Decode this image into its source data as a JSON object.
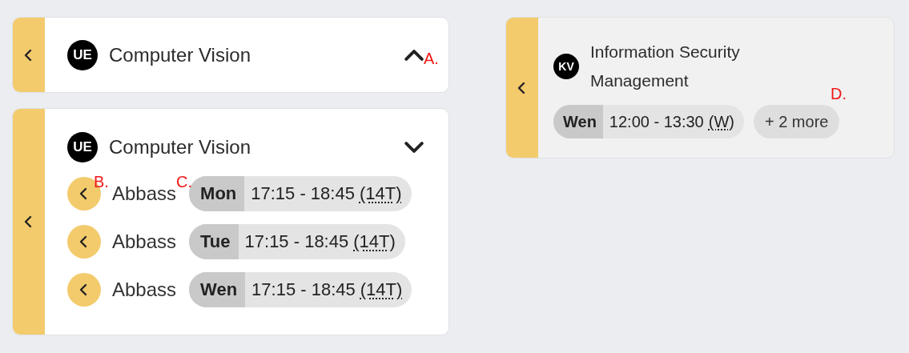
{
  "cards": [
    {
      "badge": "UE",
      "title": "Computer Vision",
      "expanded": false,
      "active": true
    },
    {
      "badge": "UE",
      "title": "Computer Vision",
      "expanded": true,
      "active": true,
      "rows": [
        {
          "teacher": "Abbass",
          "day": "Mon",
          "time": "17:15 - 18:45",
          "room": "(14T)"
        },
        {
          "teacher": "Abbass",
          "day": "Tue",
          "time": "17:15 - 18:45",
          "room": "(14T)"
        },
        {
          "teacher": "Abbass",
          "day": "Wen",
          "time": "17:15 - 18:45",
          "room": "(14T)"
        }
      ]
    },
    {
      "badge": "KV",
      "title": "Information Security Management",
      "active": false,
      "slot": {
        "day": "Wen",
        "time": "12:00 - 13:30",
        "room": "(W)"
      },
      "more": "+ 2 more"
    }
  ],
  "annotations": [
    "A.",
    "B.",
    "C.",
    "D."
  ]
}
